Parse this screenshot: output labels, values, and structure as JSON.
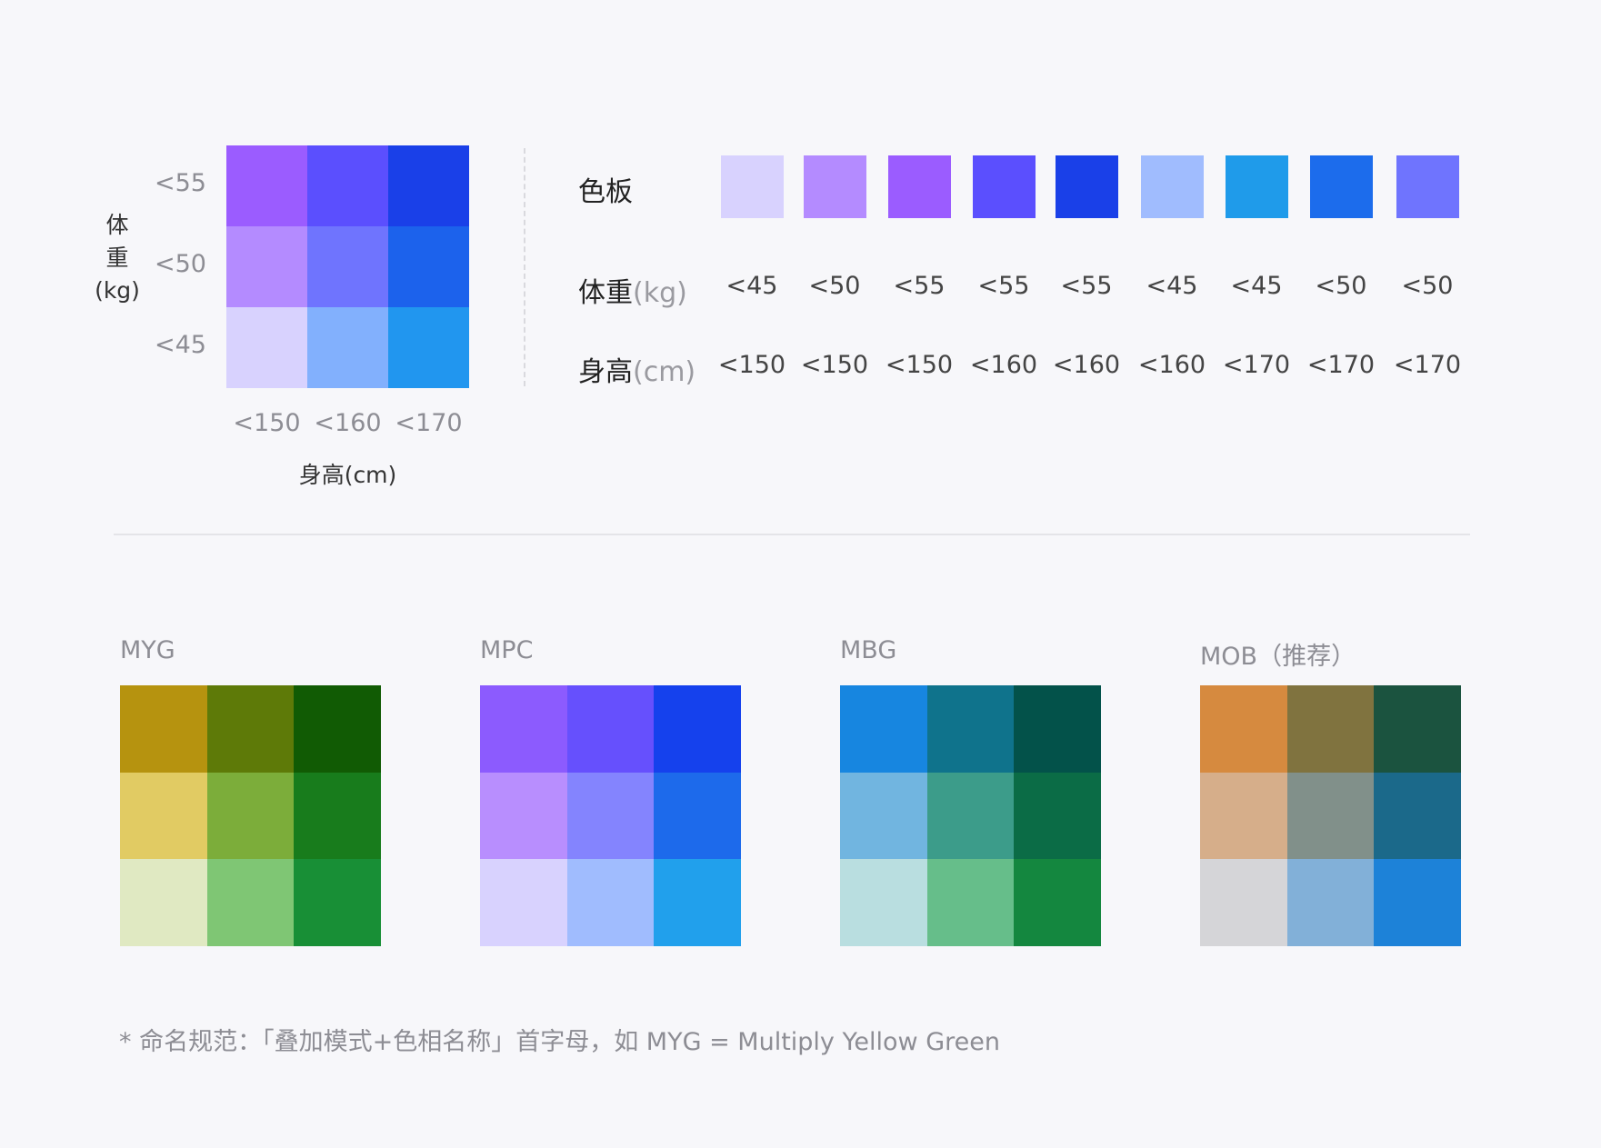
{
  "legend": {
    "y_ticks": [
      "<55",
      "<50",
      "<45"
    ],
    "x_ticks": [
      "<150",
      "<160",
      "<170"
    ],
    "y_title_chars": [
      "体",
      "重",
      "(kg)"
    ],
    "x_title": "身高(cm)",
    "cells": [
      [
        "#9b5cff",
        "#5b4ffe",
        "#1a40e8"
      ],
      [
        "#b48bff",
        "#6f74fe",
        "#1c62ec"
      ],
      [
        "#d8d2fe",
        "#82b0fd",
        "#2196ef"
      ]
    ]
  },
  "palette_table": {
    "row_labels": [
      {
        "main": "色板",
        "unit": ""
      },
      {
        "main": "体重",
        "unit": "(kg)"
      },
      {
        "main": "身高",
        "unit": "(cm)"
      }
    ],
    "swatches": [
      "#d8d2fe",
      "#b48bff",
      "#9b5cff",
      "#5b4ffe",
      "#1a40e8",
      "#a0bcfe",
      "#1f9bea",
      "#1c6cec",
      "#6f74fe"
    ],
    "weights": [
      "<45",
      "<50",
      "<55",
      "<55",
      "<55",
      "<45",
      "<45",
      "<50",
      "<50"
    ],
    "heights": [
      "<150",
      "<150",
      "<150",
      "<160",
      "<160",
      "<160",
      "<170",
      "<170",
      "<170"
    ]
  },
  "schemes": [
    {
      "title": "MYG",
      "cells": [
        [
          "#b6930f",
          "#5e7a08",
          "#115b04"
        ],
        [
          "#e1cb63",
          "#7cad3a",
          "#187c1c"
        ],
        [
          "#e0e9c2",
          "#7fc674",
          "#188f36"
        ]
      ]
    },
    {
      "title": "MPC",
      "cells": [
        [
          "#8c5bfe",
          "#6650fd",
          "#1541ed"
        ],
        [
          "#b88efe",
          "#8484fe",
          "#1d6aeb"
        ],
        [
          "#d8d2fe",
          "#a0bcfe",
          "#21a0ec"
        ]
      ]
    },
    {
      "title": "MBG",
      "cells": [
        [
          "#1786e0",
          "#0f738c",
          "#03524a"
        ],
        [
          "#71b5e0",
          "#3c9c8a",
          "#0b6c46"
        ],
        [
          "#b9dee0",
          "#66be8a",
          "#14873f"
        ]
      ]
    },
    {
      "title": "MOB（推荐）",
      "cells": [
        [
          "#d68a3f",
          "#80733f",
          "#1b533f"
        ],
        [
          "#d6ae8a",
          "#81908a",
          "#1b698a"
        ],
        [
          "#d5d5d8",
          "#82b0d8",
          "#1d82d8"
        ]
      ]
    }
  ],
  "footnote": "* 命名规范：「叠加模式+色相名称」首字母，如 MYG = Multiply Yellow Green"
}
